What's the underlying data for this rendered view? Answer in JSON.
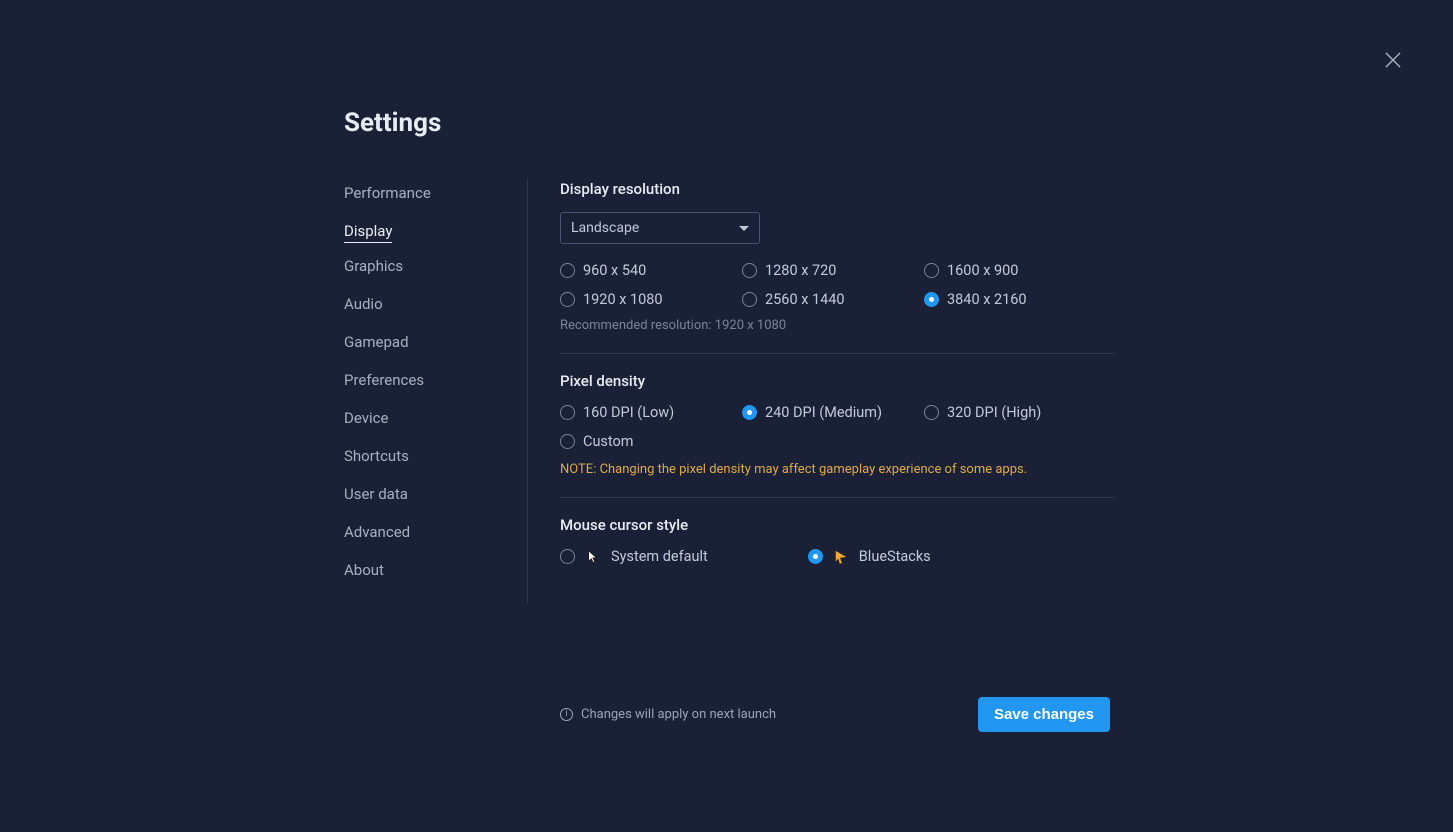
{
  "title": "Settings",
  "sidebar": {
    "items": [
      {
        "label": "Performance"
      },
      {
        "label": "Display"
      },
      {
        "label": "Graphics"
      },
      {
        "label": "Audio"
      },
      {
        "label": "Gamepad"
      },
      {
        "label": "Preferences"
      },
      {
        "label": "Device"
      },
      {
        "label": "Shortcuts"
      },
      {
        "label": "User data"
      },
      {
        "label": "Advanced"
      },
      {
        "label": "About"
      }
    ],
    "active_index": 1
  },
  "display_resolution": {
    "title": "Display resolution",
    "orientation_selected": "Landscape",
    "options": [
      {
        "label": "960 x 540"
      },
      {
        "label": "1280 x 720"
      },
      {
        "label": "1600 x 900"
      },
      {
        "label": "1920 x 1080"
      },
      {
        "label": "2560 x 1440"
      },
      {
        "label": "3840 x 2160"
      }
    ],
    "selected_index": 5,
    "recommended": "Recommended resolution: 1920 x 1080"
  },
  "pixel_density": {
    "title": "Pixel density",
    "options": [
      {
        "label": "160 DPI (Low)"
      },
      {
        "label": "240 DPI (Medium)"
      },
      {
        "label": "320 DPI (High)"
      },
      {
        "label": "Custom"
      }
    ],
    "selected_index": 1,
    "note": "NOTE: Changing the pixel density may affect gameplay experience of some apps."
  },
  "mouse_cursor": {
    "title": "Mouse cursor style",
    "options": [
      {
        "label": "System default"
      },
      {
        "label": "BlueStacks"
      }
    ],
    "selected_index": 1
  },
  "footer": {
    "info": "Changes will apply on next launch",
    "save_label": "Save changes"
  }
}
